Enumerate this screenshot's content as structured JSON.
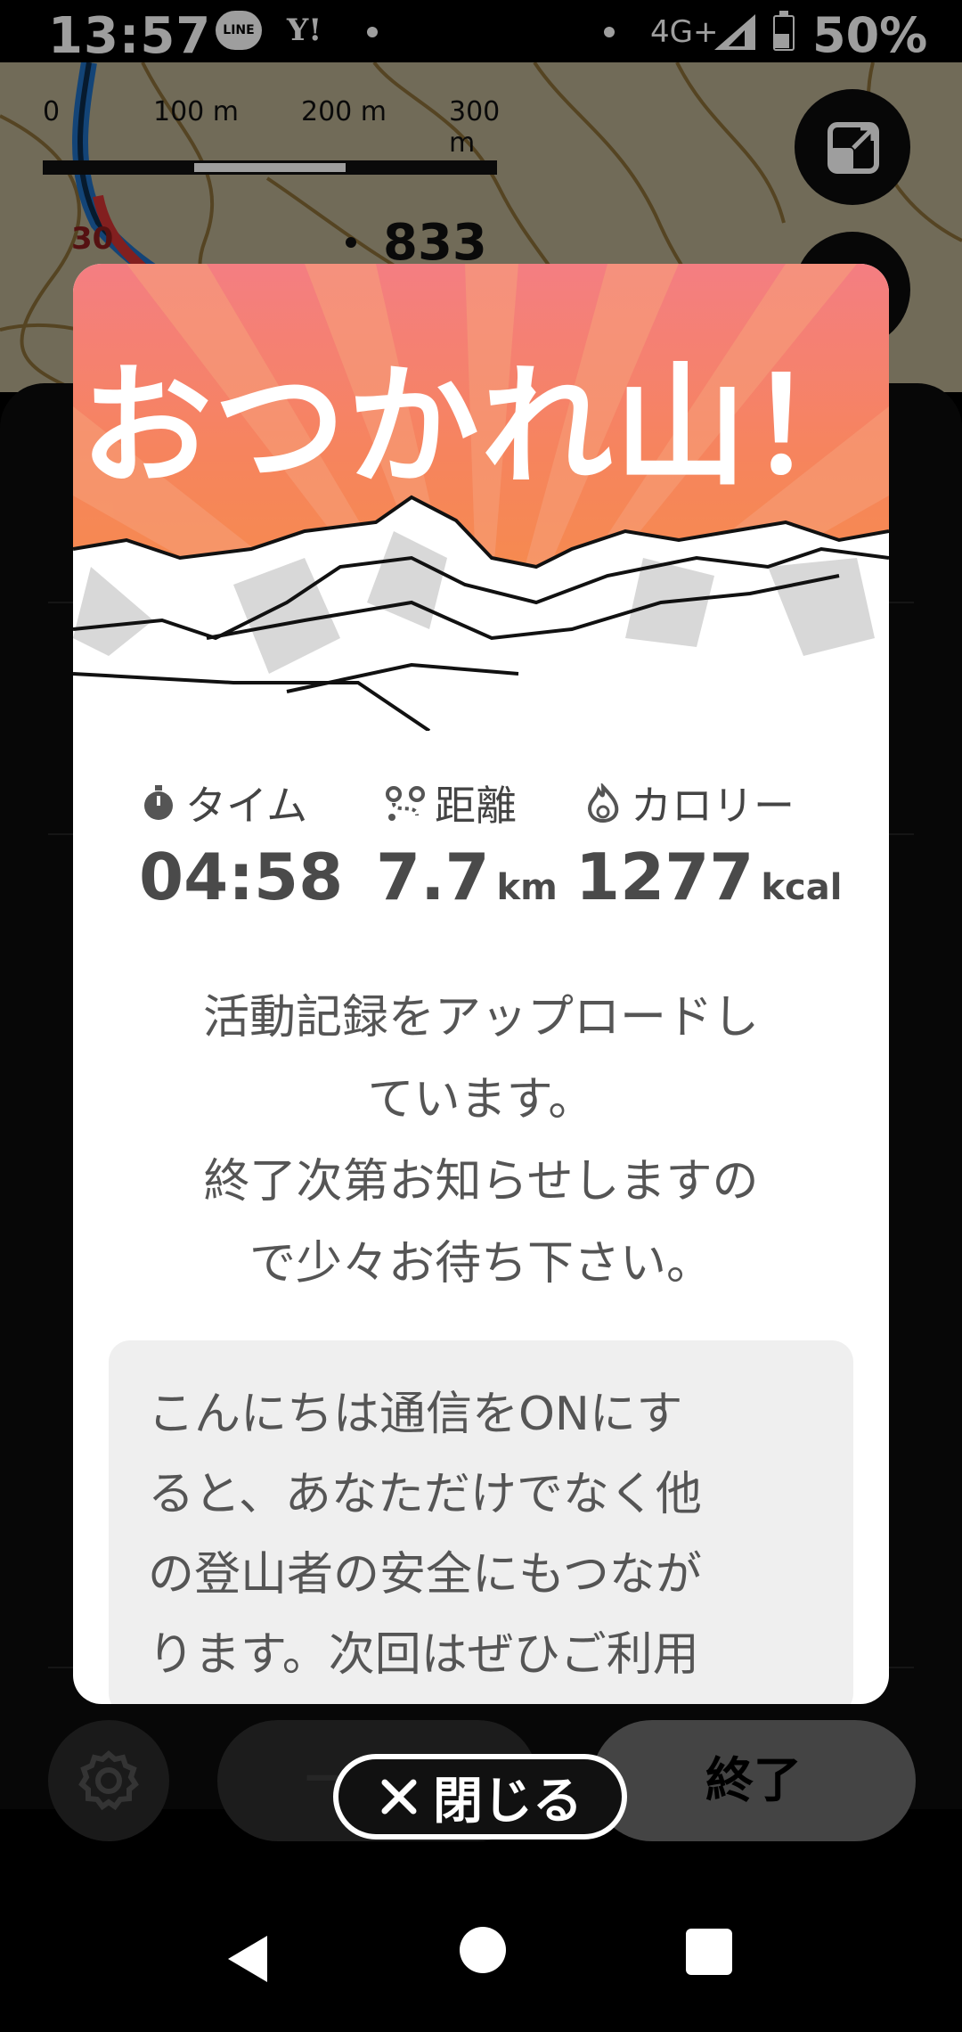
{
  "status_bar": {
    "time": "13:57",
    "line_badge": "LINE",
    "yahoo_badge": "Y!",
    "network": "4G+",
    "battery": "50%",
    "battery_level": 0.5
  },
  "map": {
    "scale_labels": [
      "0",
      "100 m",
      "200 m",
      "300 m"
    ],
    "peak_elevation": "833",
    "route_number": "30",
    "layers_icon": "layers-icon"
  },
  "modal": {
    "title": "おつかれ山！",
    "stats": [
      {
        "label": "タイム",
        "icon": "stopwatch-icon",
        "value": "04:58",
        "unit": ""
      },
      {
        "label": "距離",
        "icon": "route-icon",
        "value": "7.7",
        "unit": "km"
      },
      {
        "label": "カロリー",
        "icon": "flame-icon",
        "value": "1277",
        "unit": "kcal"
      }
    ],
    "message_lines": [
      "活動記録をアップロードし",
      "ています。",
      "終了次第お知らせしますの",
      "で少々お待ち下さい。"
    ],
    "info_lines": [
      "こんにちは通信をONにす",
      "ると、あなただけでなく他",
      "の登山者の安全にもつなが",
      "ります。次回はぜひご利用"
    ]
  },
  "close_button": {
    "icon": "close-icon",
    "label": "閉じる"
  },
  "action_bar": {
    "settings_icon": "gear-icon",
    "pause_label": "一時停",
    "end_label": "終了"
  },
  "colors": {
    "hero_top": "#f47e82",
    "hero_bottom": "#f5923b",
    "stat_text": "#4a4a4a"
  }
}
